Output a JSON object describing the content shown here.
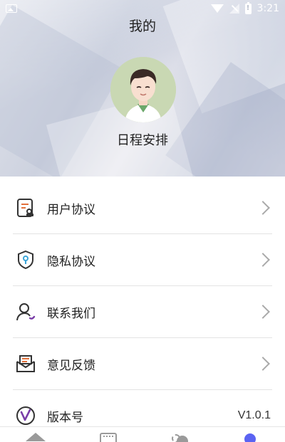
{
  "status_bar": {
    "time": "3:21",
    "icons": [
      "image-icon",
      "wifi-icon",
      "signal-off-icon",
      "battery-alert-icon"
    ]
  },
  "header": {
    "title": "我的",
    "user_name": "日程安排",
    "avatar_icon": "cartoon-man-avatar"
  },
  "menu": {
    "items": [
      {
        "label": "用户协议",
        "icon": "user-agreement-icon"
      },
      {
        "label": "隐私协议",
        "icon": "privacy-shield-icon"
      },
      {
        "label": "联系我们",
        "icon": "contact-person-icon"
      },
      {
        "label": "意见反馈",
        "icon": "feedback-envelope-icon"
      },
      {
        "label": "版本号",
        "icon": "version-v-icon",
        "value": "V1.0.1"
      }
    ]
  },
  "bottom_nav": {
    "tabs": [
      {
        "icon": "home-icon",
        "active": false
      },
      {
        "icon": "calendar-icon",
        "active": false
      },
      {
        "icon": "weather-icon",
        "active": false
      },
      {
        "icon": "profile-icon",
        "active": true
      }
    ],
    "active_color": "#5b63f2"
  },
  "colors": {
    "accent_orange": "#e2703a",
    "accent_purple": "#7a3ea8",
    "accent_blue": "#3ba5d8",
    "icon_dark": "#333333"
  }
}
